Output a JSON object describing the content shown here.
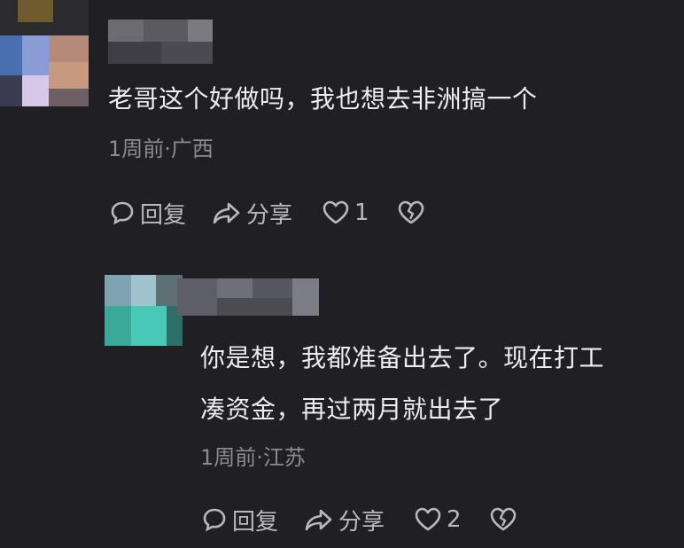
{
  "comments": [
    {
      "text_lines": [
        "老哥这个好做吗，我也想去非洲搞一个"
      ],
      "meta": "1周前·广西",
      "actions": {
        "reply": "回复",
        "share": "分享",
        "like_count": "1"
      }
    },
    {
      "text_lines": [
        "你是想，我都准备出去了。现在打工",
        "凑资金，再过两月就出去了"
      ],
      "meta": "1周前·江苏",
      "actions": {
        "reply": "回复",
        "share": "分享",
        "like_count": "2"
      }
    }
  ],
  "icons": [
    "comment-bubble-icon",
    "share-arrow-icon",
    "heart-icon",
    "broken-heart-icon"
  ],
  "colors": {
    "background": "#1f1f24",
    "text": "#ededef",
    "meta": "#8b8b90",
    "action": "#b9b9bd"
  }
}
